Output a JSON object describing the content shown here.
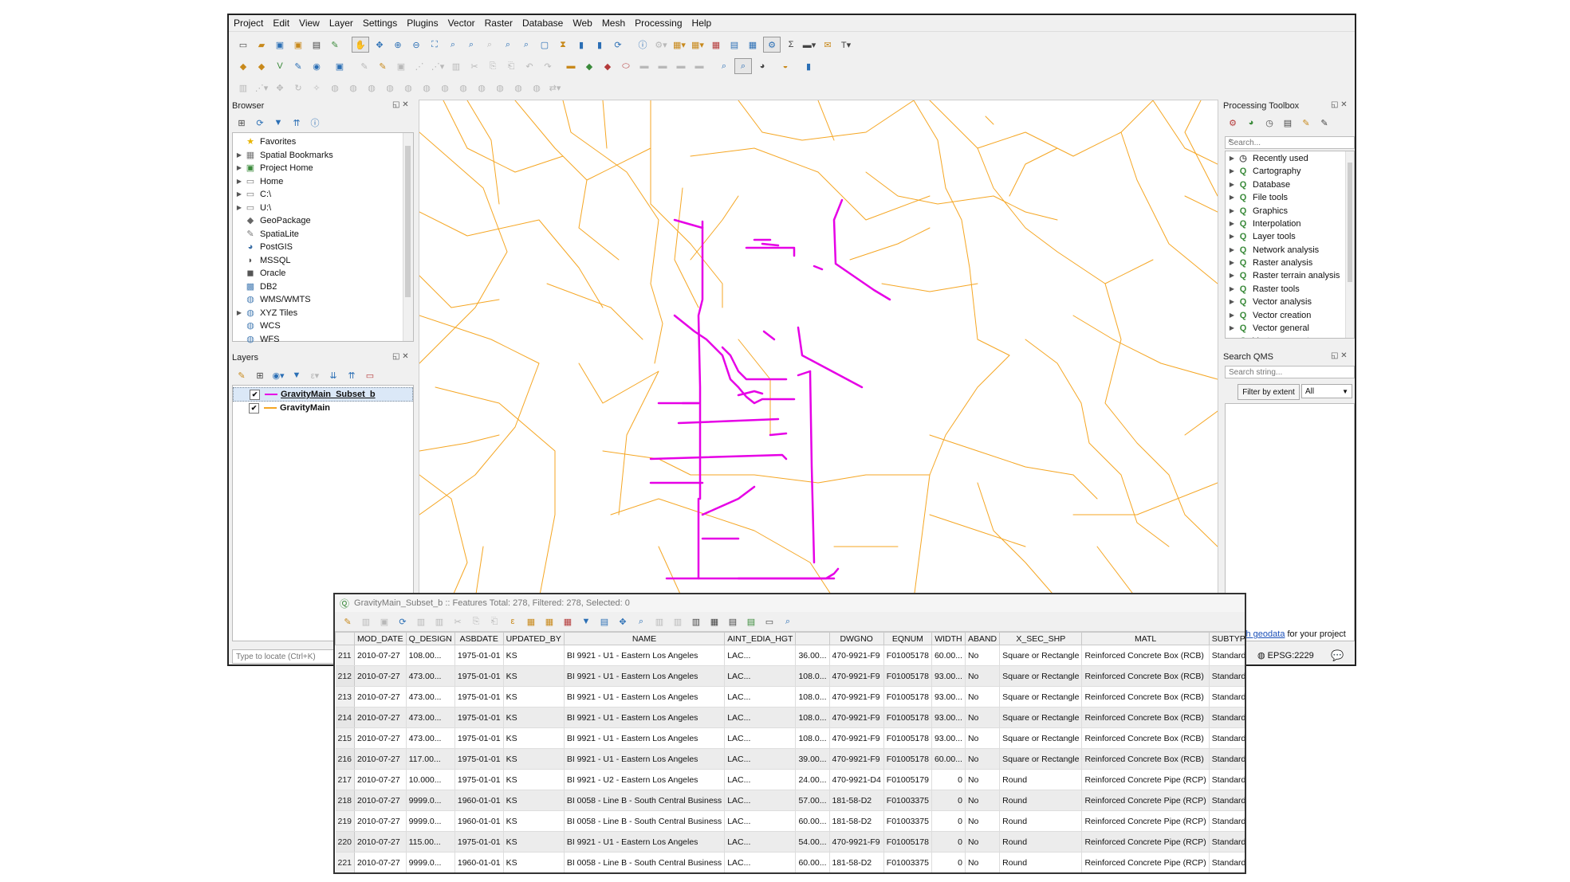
{
  "menu": [
    "Project",
    "Edit",
    "View",
    "Layer",
    "Settings",
    "Plugins",
    "Vector",
    "Raster",
    "Database",
    "Web",
    "Mesh",
    "Processing",
    "Help"
  ],
  "browser": {
    "title": "Browser",
    "items": [
      {
        "label": "Favorites",
        "icon": "star-icon",
        "expand": false
      },
      {
        "label": "Spatial Bookmarks",
        "icon": "bookmark-icon",
        "expand": true
      },
      {
        "label": "Project Home",
        "icon": "project-home-icon",
        "expand": true
      },
      {
        "label": "Home",
        "icon": "folder-icon",
        "expand": true
      },
      {
        "label": "C:\\",
        "icon": "drive-icon",
        "expand": true
      },
      {
        "label": "U:\\",
        "icon": "drive-icon",
        "expand": true
      },
      {
        "label": "GeoPackage",
        "icon": "geopackage-icon",
        "expand": false
      },
      {
        "label": "SpatiaLite",
        "icon": "spatialite-icon",
        "expand": false
      },
      {
        "label": "PostGIS",
        "icon": "postgis-icon",
        "expand": false
      },
      {
        "label": "MSSQL",
        "icon": "mssql-icon",
        "expand": false
      },
      {
        "label": "Oracle",
        "icon": "oracle-icon",
        "expand": false
      },
      {
        "label": "DB2",
        "icon": "db2-icon",
        "expand": false
      },
      {
        "label": "WMS/WMTS",
        "icon": "globe-icon",
        "expand": false
      },
      {
        "label": "XYZ Tiles",
        "icon": "globe-icon",
        "expand": true
      },
      {
        "label": "WCS",
        "icon": "globe-icon",
        "expand": false
      },
      {
        "label": "WFS",
        "icon": "globe-icon",
        "expand": false
      }
    ]
  },
  "layers": {
    "title": "Layers",
    "items": [
      {
        "label": "GravityMain_Subset_b",
        "color": "#e600e6",
        "checked": true
      },
      {
        "label": "GravityMain",
        "color": "#f5a623",
        "checked": true
      }
    ]
  },
  "processing": {
    "title": "Processing Toolbox",
    "search_placeholder": "Search...",
    "items": [
      "Recently used",
      "Cartography",
      "Database",
      "File tools",
      "Graphics",
      "Interpolation",
      "Layer tools",
      "Network analysis",
      "Raster analysis",
      "Raster terrain analysis",
      "Raster tools",
      "Vector analysis",
      "Vector creation",
      "Vector general",
      "Vector geometry"
    ]
  },
  "qms": {
    "title": "Search QMS",
    "search_placeholder": "Search string...",
    "filter_label": "Filter by extent",
    "filter_value": "All"
  },
  "status": {
    "locate_placeholder": "Type to locate (Ctrl+K)",
    "geodata_link": "sh geodata",
    "geodata_suffix": "for your project",
    "crs": "EPSG:2229"
  },
  "colors": {
    "network": "#f5a623",
    "subset": "#e600e6"
  },
  "attribute_table": {
    "title": "GravityMain_Subset_b :: Features Total: 278, Filtered: 278, Selected: 0",
    "columns": [
      "MOD_DATE",
      "Q_DESIGN",
      "ASBDATE",
      "UPDATED_BY",
      "NAME",
      "MAINT_EDIA_HGT",
      "DWGNO",
      "EQNUM",
      "WIDTH",
      "ABAND",
      "X_SEC_SHP",
      "MATL",
      "SUBTYPE"
    ],
    "header_display": [
      "MOD_DATE",
      "Q_DESIGN",
      "ASBDATE",
      "UPDATED_BY",
      "NAME",
      "AINT_EDIA_HGT",
      "DWGNO",
      "EQNUM",
      "WIDTH",
      "ABAND",
      "X_SEC_SHP",
      "MATL",
      "SUBTYPE"
    ],
    "rows": [
      {
        "id": "211",
        "cells": [
          "2010-07-27",
          "108.00...",
          "1975-01-01",
          "KS",
          "BI 9921 - U1 - Eastern Los Angeles",
          "LAC...",
          "36.00...",
          "470-9921-F9",
          "F01005178",
          "60.00...",
          "No",
          "Square or Rectangle",
          "Reinforced Concrete Box (RCB)",
          "Standard"
        ]
      },
      {
        "id": "212",
        "cells": [
          "2010-07-27",
          "473.00...",
          "1975-01-01",
          "KS",
          "BI 9921 - U1 - Eastern Los Angeles",
          "LAC...",
          "108.0...",
          "470-9921-F9",
          "F01005178",
          "93.00...",
          "No",
          "Square or Rectangle",
          "Reinforced Concrete Box (RCB)",
          "Standard"
        ]
      },
      {
        "id": "213",
        "cells": [
          "2010-07-27",
          "473.00...",
          "1975-01-01",
          "KS",
          "BI 9921 - U1 - Eastern Los Angeles",
          "LAC...",
          "108.0...",
          "470-9921-F9",
          "F01005178",
          "93.00...",
          "No",
          "Square or Rectangle",
          "Reinforced Concrete Box (RCB)",
          "Standard"
        ]
      },
      {
        "id": "214",
        "cells": [
          "2010-07-27",
          "473.00...",
          "1975-01-01",
          "KS",
          "BI 9921 - U1 - Eastern Los Angeles",
          "LAC...",
          "108.0...",
          "470-9921-F9",
          "F01005178",
          "93.00...",
          "No",
          "Square or Rectangle",
          "Reinforced Concrete Box (RCB)",
          "Standard"
        ]
      },
      {
        "id": "215",
        "cells": [
          "2010-07-27",
          "473.00...",
          "1975-01-01",
          "KS",
          "BI 9921 - U1 - Eastern Los Angeles",
          "LAC...",
          "108.0...",
          "470-9921-F9",
          "F01005178",
          "93.00...",
          "No",
          "Square or Rectangle",
          "Reinforced Concrete Box (RCB)",
          "Standard"
        ]
      },
      {
        "id": "216",
        "cells": [
          "2010-07-27",
          "117.00...",
          "1975-01-01",
          "KS",
          "BI 9921 - U1 - Eastern Los Angeles",
          "LAC...",
          "39.00...",
          "470-9921-F9",
          "F01005178",
          "60.00...",
          "No",
          "Square or Rectangle",
          "Reinforced Concrete Box (RCB)",
          "Standard"
        ]
      },
      {
        "id": "217",
        "cells": [
          "2010-07-27",
          "10.000...",
          "1975-01-01",
          "KS",
          "BI 9921 - U2 - Eastern Los Angeles",
          "LAC...",
          "24.00...",
          "470-9921-D4",
          "F01005179",
          "0",
          "No",
          "Round",
          "Reinforced Concrete Pipe (RCP)",
          "Standard"
        ]
      },
      {
        "id": "218",
        "cells": [
          "2010-07-27",
          "9999.0...",
          "1960-01-01",
          "KS",
          "BI 0058 - Line B - South Central Business",
          "LAC...",
          "57.00...",
          "181-58-D2",
          "F01003375",
          "0",
          "No",
          "Round",
          "Reinforced Concrete Pipe (RCP)",
          "Standard"
        ]
      },
      {
        "id": "219",
        "cells": [
          "2010-07-27",
          "9999.0...",
          "1960-01-01",
          "KS",
          "BI 0058 - Line B - South Central Business",
          "LAC...",
          "60.00...",
          "181-58-D2",
          "F01003375",
          "0",
          "No",
          "Round",
          "Reinforced Concrete Pipe (RCP)",
          "Standard"
        ]
      },
      {
        "id": "220",
        "cells": [
          "2010-07-27",
          "115.00...",
          "1975-01-01",
          "KS",
          "BI 9921 - U1 - Eastern Los Angeles",
          "LAC...",
          "54.00...",
          "470-9921-F9",
          "F01005178",
          "0",
          "No",
          "Round",
          "Reinforced Concrete Pipe (RCP)",
          "Standard"
        ]
      },
      {
        "id": "221",
        "cells": [
          "2010-07-27",
          "9999.0...",
          "1960-01-01",
          "KS",
          "BI 0058 - Line B - South Central Business",
          "LAC...",
          "60.00...",
          "181-58-D2",
          "F01003375",
          "0",
          "No",
          "Round",
          "Reinforced Concrete Pipe (RCP)",
          "Standard"
        ]
      }
    ]
  }
}
